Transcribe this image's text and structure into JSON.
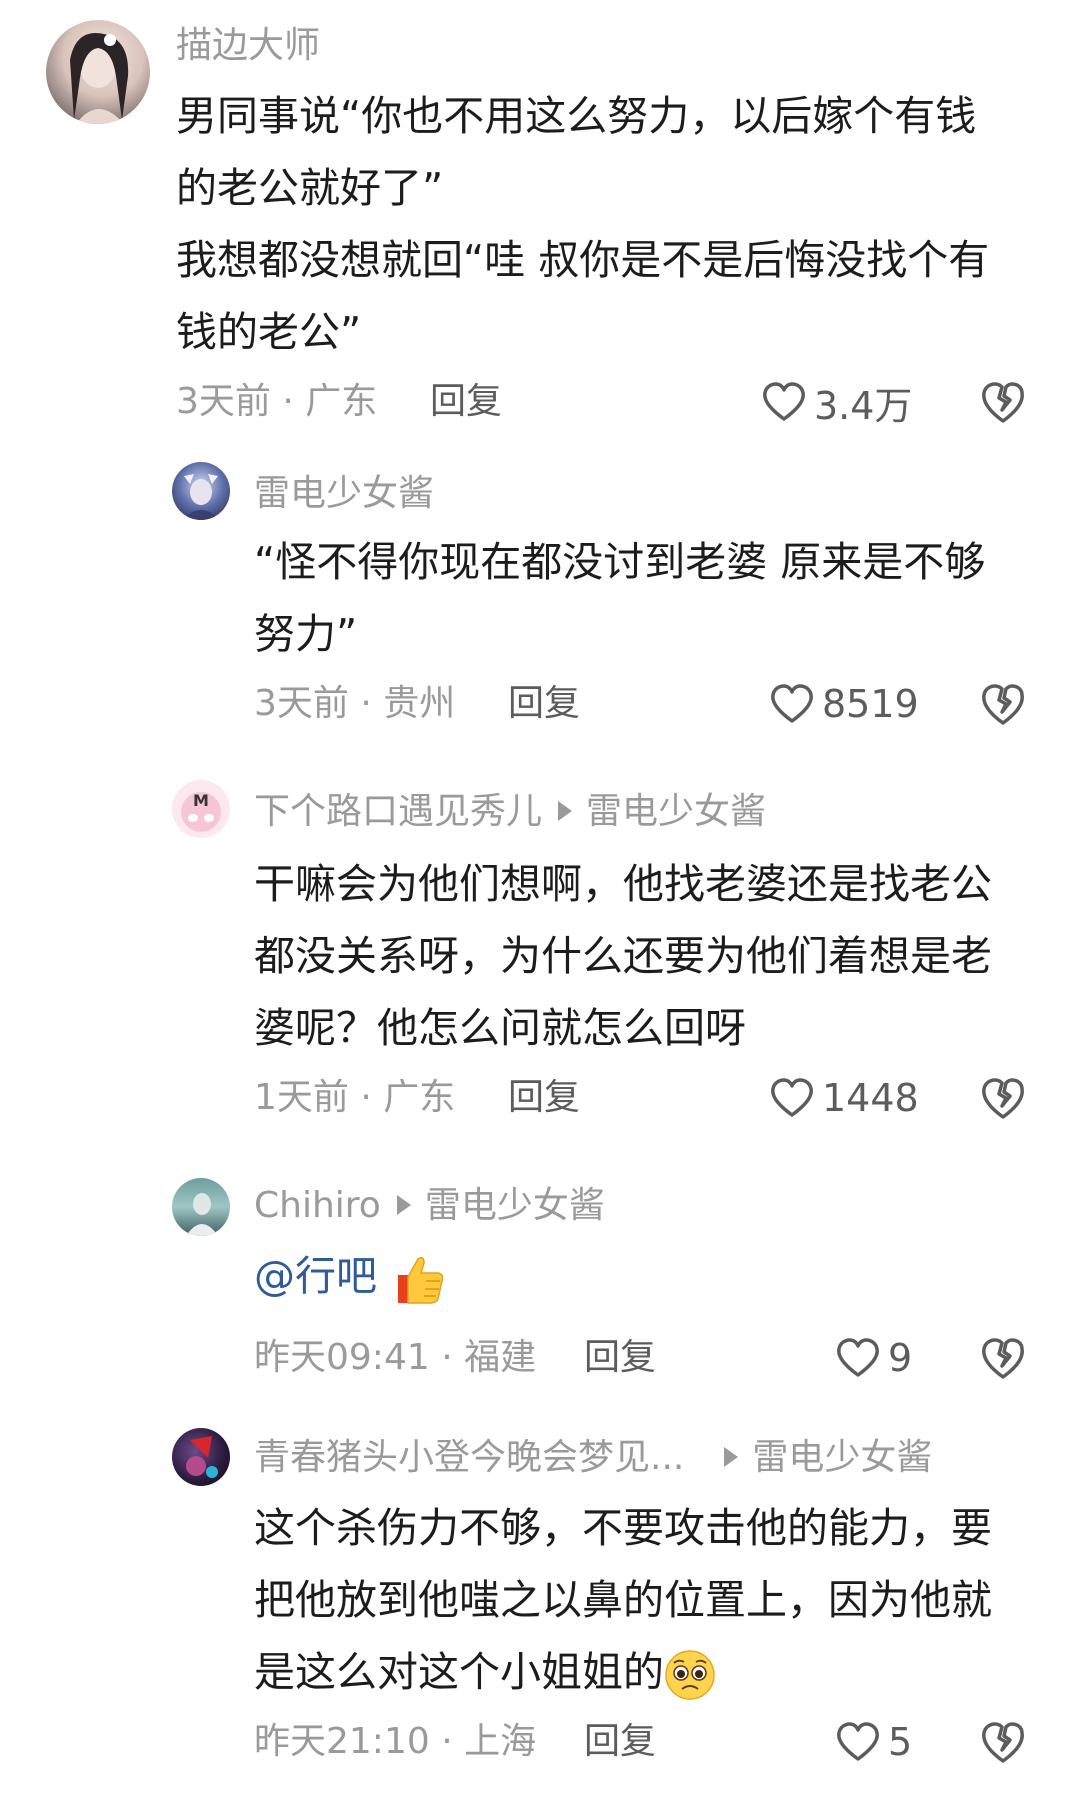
{
  "comments": [
    {
      "username": "描边大师",
      "lines": [
        "男同事说“你也不用这么努力，以后嫁个有钱",
        "的老公就好了”",
        "我想都没想就回“哇 叔你是不是后悔没找个有",
        "钱的老公”"
      ],
      "time_location": "3天前 · 广东",
      "reply_label": "回复",
      "likes": "3.4万"
    },
    {
      "username": "雷电少女酱",
      "lines": [
        "“怪不得你现在都没讨到老婆 原来是不够",
        "努力”"
      ],
      "time_location": "3天前 · 贵州",
      "reply_label": "回复",
      "likes": "8519"
    },
    {
      "username": "下个路口遇见秀儿",
      "reply_to": "雷电少女酱",
      "lines": [
        "干嘛会为他们想啊，他找老婆还是找老公",
        "都没关系呀，为什么还要为他们着想是老",
        "婆呢？他怎么问就怎么回呀"
      ],
      "time_location": "1天前 · 广东",
      "reply_label": "回复",
      "likes": "1448"
    },
    {
      "username": "Chihiro",
      "reply_to": "雷电少女酱",
      "mention": "@行吧",
      "time_location": "昨天09:41 · 福建",
      "reply_label": "回复",
      "likes": "9"
    },
    {
      "username": "青春猪头小登今晚会梦见...",
      "reply_to": "雷电少女酱",
      "lines": [
        "这个杀伤力不够，不要攻击他的能力，要",
        "把他放到他嗤之以鼻的位置上，因为他就",
        "是这么对这个小姐姐的"
      ],
      "time_location": "昨天21:10 · 上海",
      "reply_label": "回复",
      "likes": "5"
    }
  ],
  "colors": {
    "meta_gray": "#9a9a9a",
    "text_dark": "#1c1c1c",
    "mention_blue": "#2f5b9a"
  },
  "icons": [
    "heart-outline-icon",
    "broken-heart-icon",
    "thumbs-up-emoji",
    "pleading-face-emoji",
    "play-arrow-icon"
  ]
}
